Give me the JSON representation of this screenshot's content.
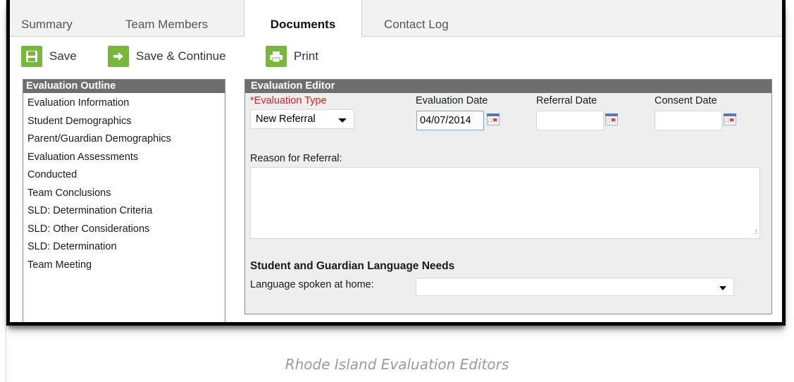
{
  "tabs": [
    {
      "label": "Summary"
    },
    {
      "label": "Team Members"
    },
    {
      "label": "Documents"
    },
    {
      "label": "Contact Log"
    }
  ],
  "toolbar": {
    "save_label": "Save",
    "save_continue_label": "Save & Continue",
    "print_label": "Print"
  },
  "outline": {
    "title": "Evaluation Outline",
    "items": [
      "Evaluation Information",
      "Student Demographics",
      "Parent/Guardian Demographics",
      "Evaluation Assessments",
      "Conducted",
      "Team Conclusions",
      "SLD: Determination Criteria",
      "SLD: Other Considerations",
      "SLD: Determination",
      "Team Meeting"
    ]
  },
  "editor": {
    "title": "Evaluation Editor",
    "evaluation_type_label": "*Evaluation Type",
    "evaluation_type_value": "New Referral",
    "evaluation_date_label": "Evaluation Date",
    "evaluation_date_value": "04/07/2014",
    "referral_date_label": "Referral Date",
    "referral_date_value": "",
    "consent_date_label": "Consent Date",
    "consent_date_value": "",
    "reason_label": "Reason for Referral:",
    "reason_value": "",
    "language_section_title": "Student and Guardian Language Needs",
    "language_label": "Language spoken at home:",
    "language_value": ""
  },
  "colors": {
    "toolbar_icon_green": "#75b83b",
    "header_gray": "#6e6e6e",
    "required_red": "#e02020"
  },
  "caption": "Rhode Island Evaluation Editors"
}
